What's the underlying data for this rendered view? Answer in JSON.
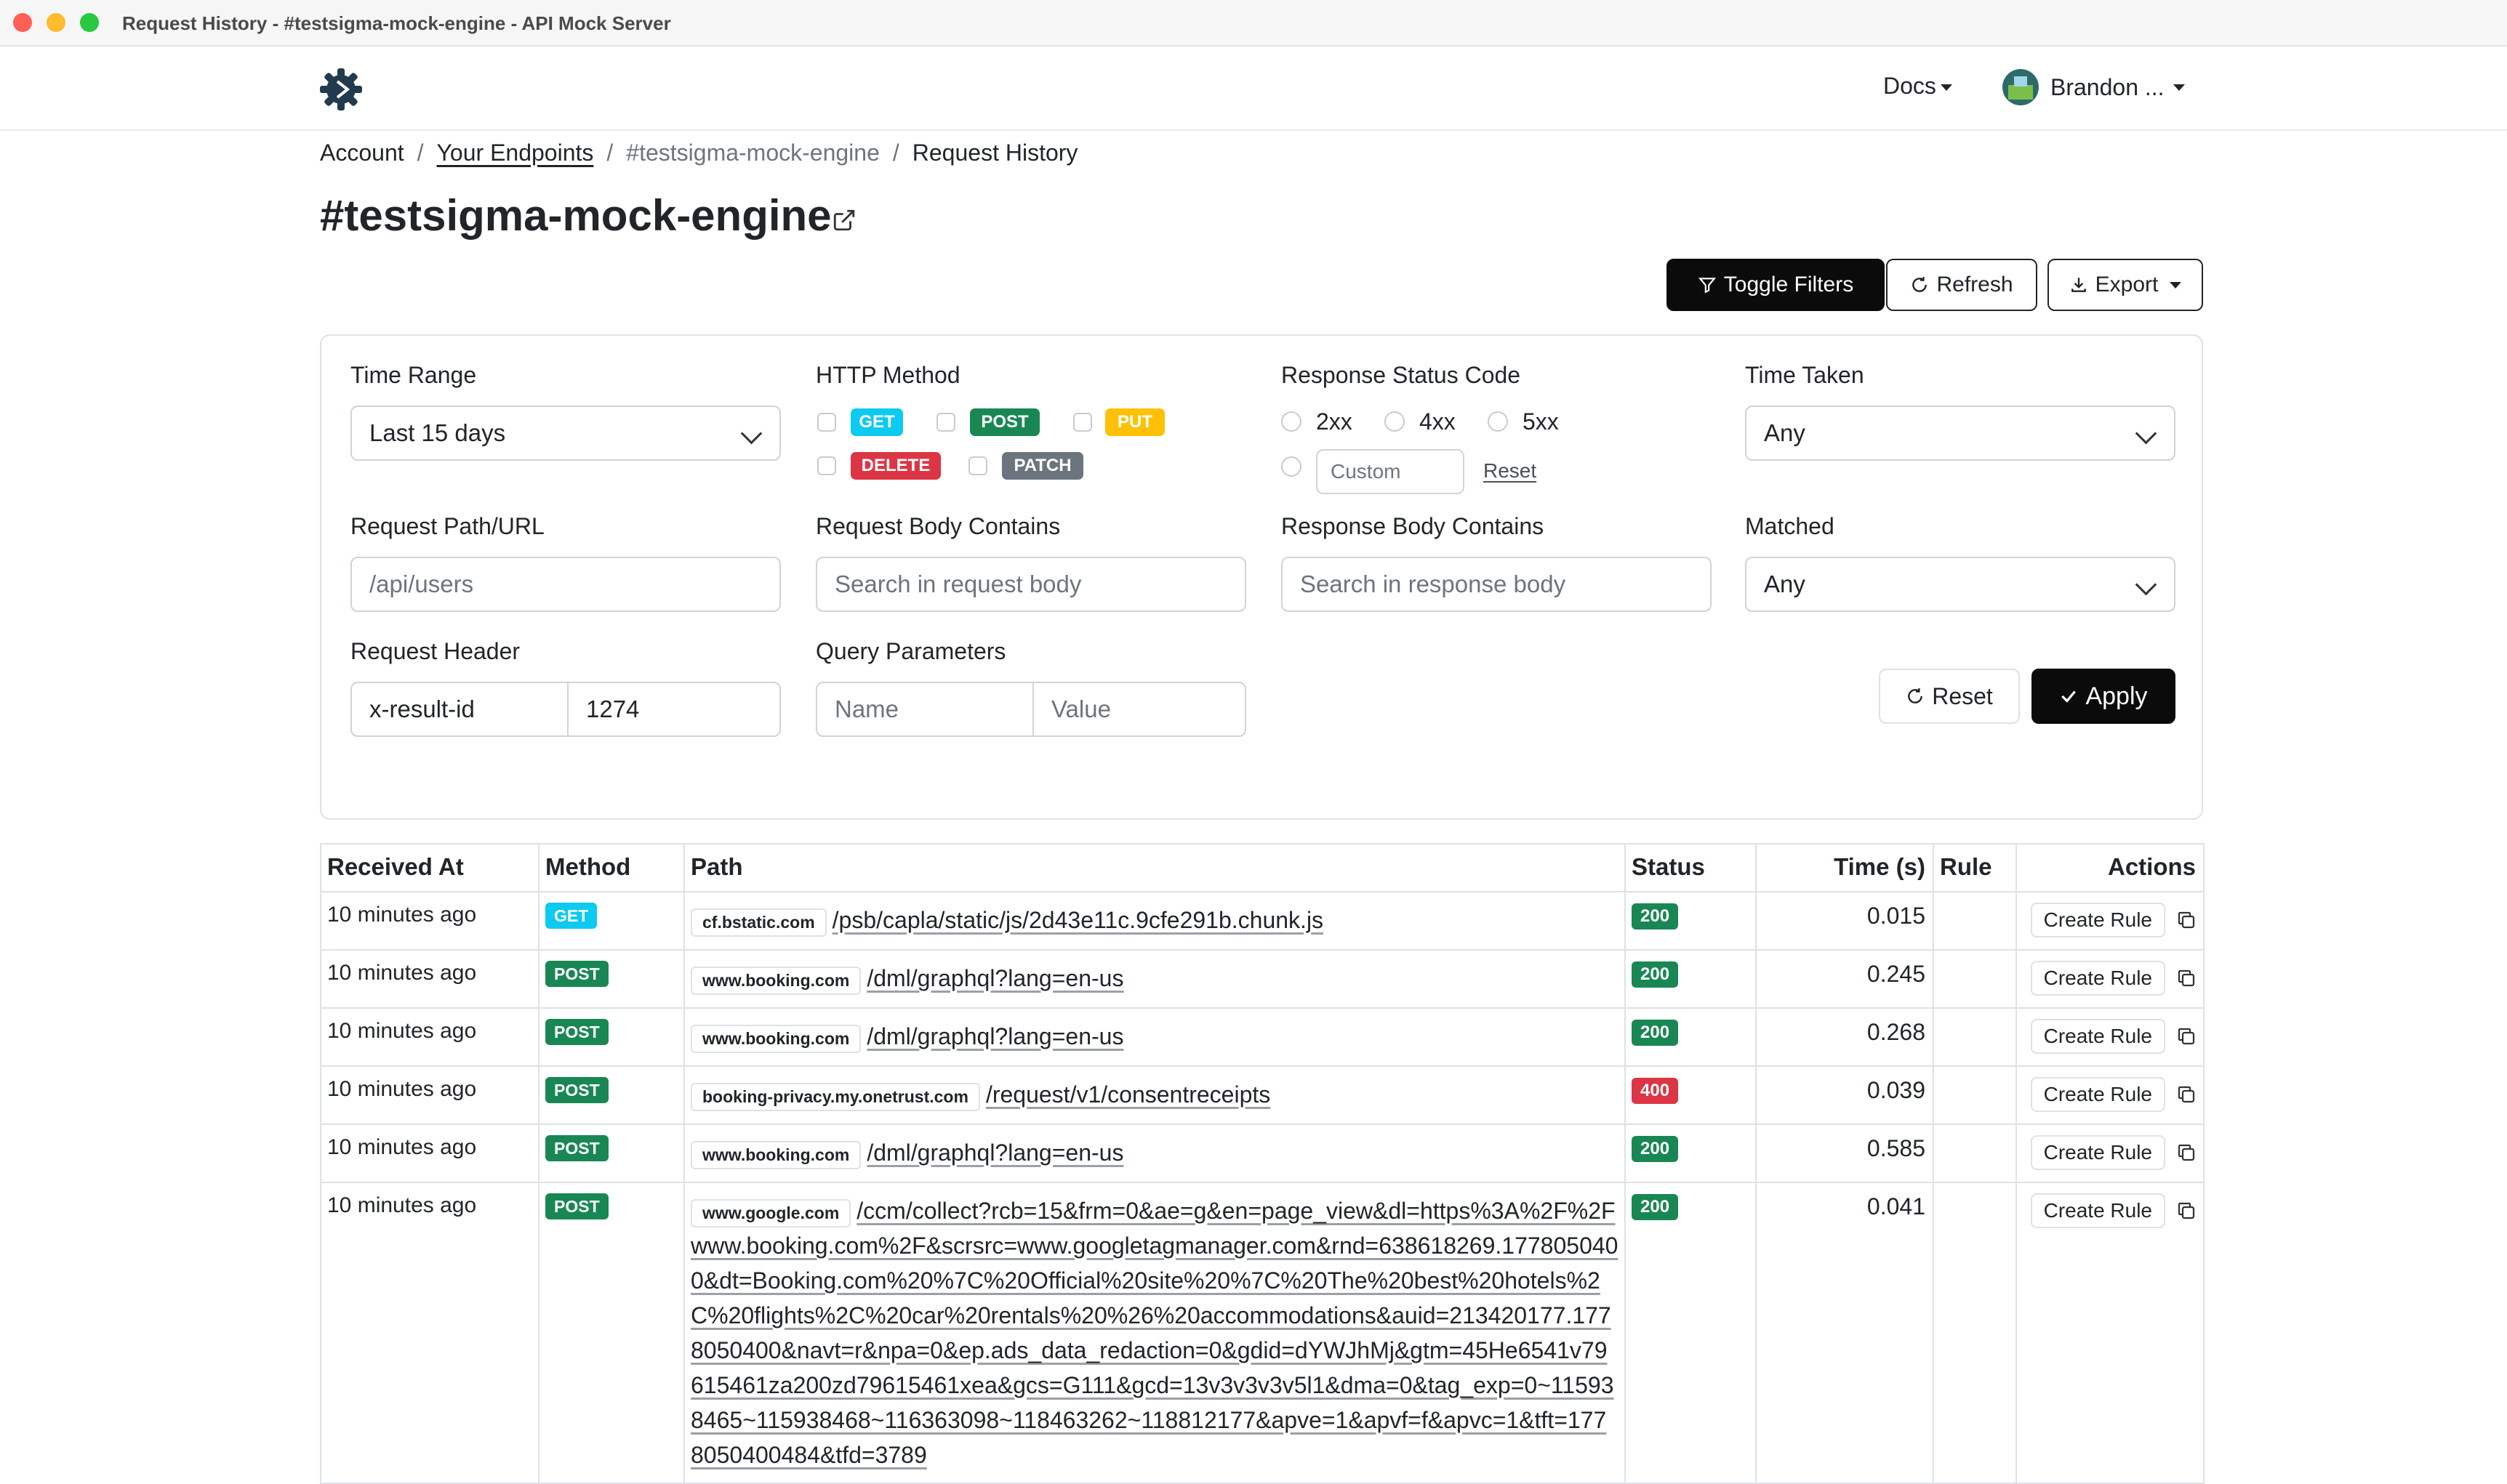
{
  "window": {
    "title": "Request History - #testsigma-mock-engine - API Mock Server"
  },
  "nav": {
    "docs": "Docs",
    "user": "Brandon ..."
  },
  "breadcrumb": {
    "account": "Account",
    "endpoints": "Your Endpoints",
    "endpoint": "#testsigma-mock-engine",
    "current": "Request History"
  },
  "page": {
    "title": "#testsigma-mock-engine"
  },
  "toolbar": {
    "toggle_filters": "Toggle Filters",
    "refresh": "Refresh",
    "export": "Export"
  },
  "filters": {
    "time_range": {
      "label": "Time Range",
      "value": "Last 15 days"
    },
    "http_method": {
      "label": "HTTP Method",
      "options": [
        "GET",
        "POST",
        "PUT",
        "DELETE",
        "PATCH"
      ]
    },
    "status_code": {
      "label": "Response Status Code",
      "options": [
        "2xx",
        "4xx",
        "5xx"
      ],
      "custom_placeholder": "Custom",
      "reset": "Reset"
    },
    "time_taken": {
      "label": "Time Taken",
      "value": "Any"
    },
    "path": {
      "label": "Request Path/URL",
      "placeholder": "/api/users"
    },
    "request_body": {
      "label": "Request Body Contains",
      "placeholder": "Search in request body"
    },
    "response_body": {
      "label": "Response Body Contains",
      "placeholder": "Search in response body"
    },
    "matched": {
      "label": "Matched",
      "value": "Any"
    },
    "request_header": {
      "label": "Request Header",
      "name": "x-result-id",
      "value": "1274"
    },
    "query_params": {
      "label": "Query Parameters",
      "name_placeholder": "Name",
      "value_placeholder": "Value"
    },
    "reset": "Reset",
    "apply": "Apply"
  },
  "table": {
    "headers": [
      "Received At",
      "Method",
      "Path",
      "Status",
      "Time (s)",
      "Rule",
      "Actions"
    ],
    "action_label": "Create Rule",
    "rows": [
      {
        "received": "10 minutes ago",
        "method": "GET",
        "host": "cf.bstatic.com",
        "path": "/psb/capla/static/js/2d43e11c.9cfe291b.chunk.js",
        "status": "200",
        "time": "0.015"
      },
      {
        "received": "10 minutes ago",
        "method": "POST",
        "host": "www.booking.com",
        "path": "/dml/graphql?lang=en-us",
        "status": "200",
        "time": "0.245"
      },
      {
        "received": "10 minutes ago",
        "method": "POST",
        "host": "www.booking.com",
        "path": "/dml/graphql?lang=en-us",
        "status": "200",
        "time": "0.268"
      },
      {
        "received": "10 minutes ago",
        "method": "POST",
        "host": "booking-privacy.my.onetrust.com",
        "path": "/request/v1/consentreceipts",
        "status": "400",
        "time": "0.039"
      },
      {
        "received": "10 minutes ago",
        "method": "POST",
        "host": "www.booking.com",
        "path": "/dml/graphql?lang=en-us",
        "status": "200",
        "time": "0.585"
      },
      {
        "received": "10 minutes ago",
        "method": "POST",
        "host": "www.google.com",
        "path": "/ccm/collect?rcb=15&frm=0&ae=g&en=page_view&dl=https%3A%2F%2Fwww.booking.com%2F&scrsrc=www.googletagmanager.com&rnd=638618269.1778050400&dt=Booking.com%20%7C%20Official%20site%20%7C%20The%20best%20hotels%2C%20flights%2C%20car%20rentals%20%26%20accommodations&auid=213420177.1778050400&navt=r&npa=0&ep.ads_data_redaction=0&gdid=dYWJhMj&gtm=45He6541v79615461za200zd79615461xea&gcs=G111&gcd=13v3v3v3v5l1&dma=0&tag_exp=0~115938465~115938468~116363098~118463262~118812177&apve=1&apvf=f&apvc=1&tft=1778050400484&tfd=3789",
        "status": "200",
        "time": "0.041"
      }
    ]
  }
}
